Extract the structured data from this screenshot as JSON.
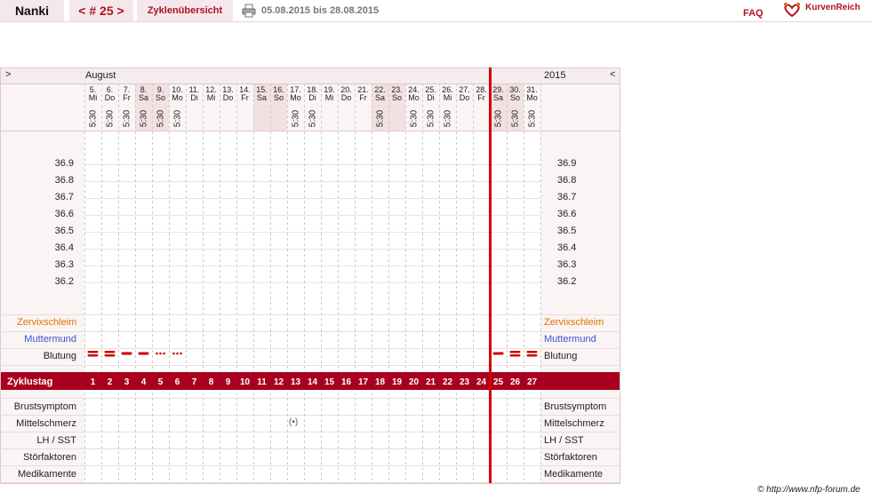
{
  "topbar": {
    "user": "Nanki",
    "cycle_nav": "< # 25 >",
    "overview": "Zyklenübersicht",
    "date_range": "05.08.2015 bis 28.08.2015",
    "faq": "FAQ",
    "logo": "KurvenReich",
    "printer_icon": "printer-icon",
    "logo_icon": "heart-logo-icon"
  },
  "chart": {
    "nav_left": ">",
    "nav_right": "<",
    "month": "August",
    "year": "2015",
    "days": [
      {
        "d": "5.",
        "w": "Mi",
        "t": "5:30",
        "we": false
      },
      {
        "d": "6.",
        "w": "Do",
        "t": "5:30",
        "we": false
      },
      {
        "d": "7.",
        "w": "Fr",
        "t": "5:30",
        "we": false
      },
      {
        "d": "8.",
        "w": "Sa",
        "t": "5:30",
        "we": true
      },
      {
        "d": "9.",
        "w": "So",
        "t": "5:30",
        "we": true
      },
      {
        "d": "10.",
        "w": "Mo",
        "t": "5:30",
        "we": false
      },
      {
        "d": "11.",
        "w": "Di",
        "t": "",
        "we": false
      },
      {
        "d": "12.",
        "w": "Mi",
        "t": "",
        "we": false
      },
      {
        "d": "13.",
        "w": "Do",
        "t": "",
        "we": false
      },
      {
        "d": "14.",
        "w": "Fr",
        "t": "",
        "we": false
      },
      {
        "d": "15.",
        "w": "Sa",
        "t": "",
        "we": true
      },
      {
        "d": "16.",
        "w": "So",
        "t": "",
        "we": true
      },
      {
        "d": "17.",
        "w": "Mo",
        "t": "5:30",
        "we": false
      },
      {
        "d": "18.",
        "w": "Di",
        "t": "5:30",
        "we": false
      },
      {
        "d": "19.",
        "w": "Mi",
        "t": "",
        "we": false
      },
      {
        "d": "20.",
        "w": "Do",
        "t": "",
        "we": false
      },
      {
        "d": "21.",
        "w": "Fr",
        "t": "",
        "we": false
      },
      {
        "d": "22.",
        "w": "Sa",
        "t": "5:30",
        "we": true
      },
      {
        "d": "23.",
        "w": "So",
        "t": "",
        "we": true
      },
      {
        "d": "24.",
        "w": "Mo",
        "t": "5:30",
        "we": false
      },
      {
        "d": "25.",
        "w": "Di",
        "t": "5:30",
        "we": false
      },
      {
        "d": "26.",
        "w": "Mi",
        "t": "5:30",
        "we": false
      },
      {
        "d": "27.",
        "w": "Do",
        "t": "",
        "we": false
      },
      {
        "d": "28.",
        "w": "Fr",
        "t": "",
        "we": false
      },
      {
        "d": "29.",
        "w": "Sa",
        "t": "5:30",
        "we": true
      },
      {
        "d": "30.",
        "w": "So",
        "t": "5:30",
        "we": true
      },
      {
        "d": "31.",
        "w": "Mo",
        "t": "5:30",
        "we": false
      }
    ],
    "temperature_ticks": [
      "36.9",
      "36.8",
      "36.7",
      "36.6",
      "36.5",
      "36.4",
      "36.3",
      "36.2"
    ],
    "rows": {
      "zervix": "Zervixschleim",
      "muttermund": "Muttermund",
      "blutung": "Blutung",
      "zyklustag": "Zyklustag",
      "brust": "Brustsymptom",
      "mittelschmerz": "Mittelschmerz",
      "lh": "LH / SST",
      "stoer": "Störfaktoren",
      "medi": "Medikamente"
    },
    "cycle_days": [
      "1",
      "2",
      "3",
      "4",
      "5",
      "6",
      "7",
      "8",
      "9",
      "10",
      "11",
      "12",
      "13",
      "14",
      "15",
      "16",
      "17",
      "18",
      "19",
      "20",
      "21",
      "22",
      "23",
      "24",
      "25",
      "26",
      "27"
    ],
    "bleeding": [
      {
        "day": 1,
        "type": "double"
      },
      {
        "day": 2,
        "type": "double"
      },
      {
        "day": 3,
        "type": "single"
      },
      {
        "day": 4,
        "type": "single"
      },
      {
        "day": 5,
        "type": "dots"
      },
      {
        "day": 6,
        "type": "dots"
      },
      {
        "day": 25,
        "type": "single"
      },
      {
        "day": 26,
        "type": "double"
      },
      {
        "day": 27,
        "type": "double"
      }
    ],
    "mittelschmerz_marks": [
      {
        "day": 13,
        "symbol": "(•)"
      }
    ],
    "cycle_boundary_after_day": 24,
    "colors": {
      "accent": "#a8001e",
      "red_line": "#d40000",
      "weekend": "#f2e0e2",
      "zervix": "#e07000",
      "muttermund": "#3a55c8"
    }
  },
  "footer": {
    "copyright": "© http://www.nfp-forum.de"
  }
}
